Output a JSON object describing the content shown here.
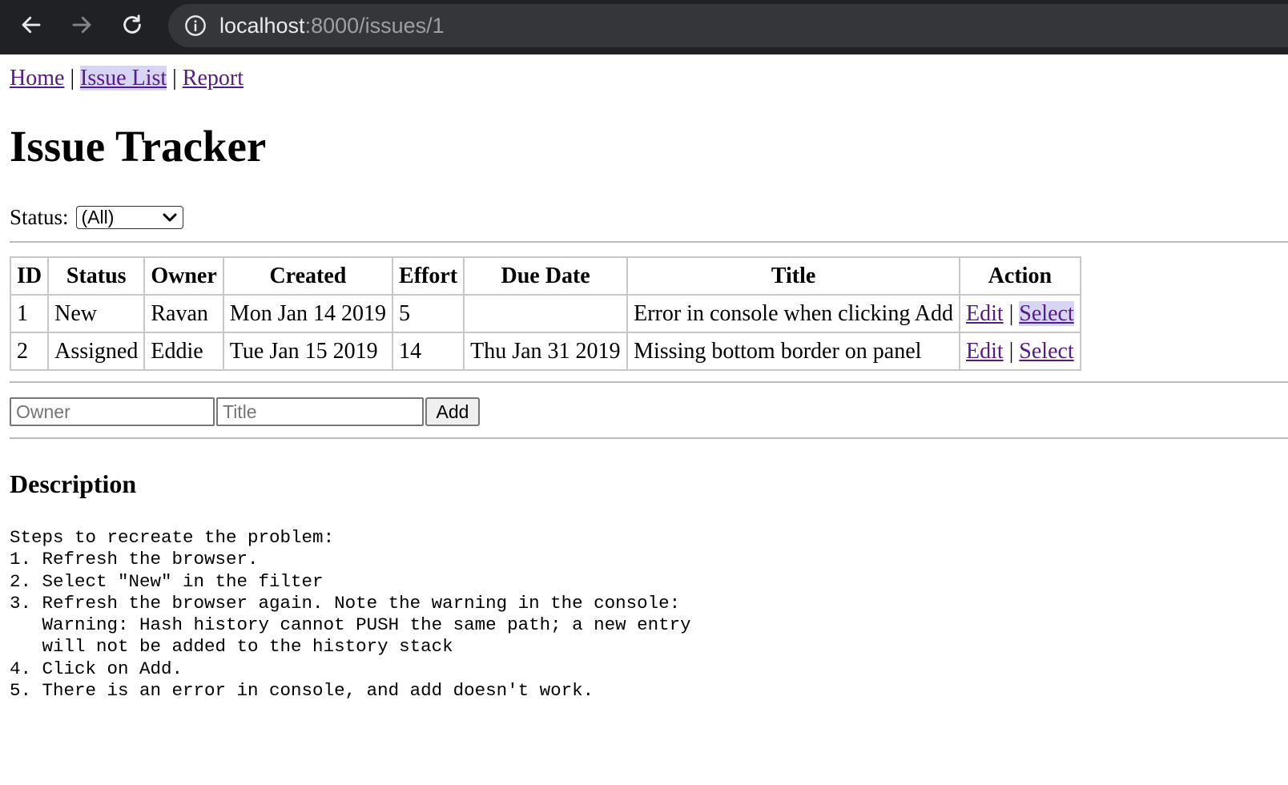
{
  "browser": {
    "url_host": "localhost",
    "url_path": ":8000/issues/1"
  },
  "nav": {
    "home": "Home",
    "issue_list": "Issue List",
    "report": "Report",
    "separator": "|"
  },
  "page_title": "Issue Tracker",
  "filter": {
    "label": "Status:",
    "selected": "(All)"
  },
  "table": {
    "headers": [
      "ID",
      "Status",
      "Owner",
      "Created",
      "Effort",
      "Due Date",
      "Title",
      "Action"
    ],
    "rows": [
      {
        "id": "1",
        "status": "New",
        "owner": "Ravan",
        "created": "Mon Jan 14 2019",
        "effort": "5",
        "due": "",
        "title": "Error in console when clicking Add",
        "edit": "Edit",
        "select": "Select"
      },
      {
        "id": "2",
        "status": "Assigned",
        "owner": "Eddie",
        "created": "Tue Jan 15 2019",
        "effort": "14",
        "due": "Thu Jan 31 2019",
        "title": "Missing bottom border on panel",
        "edit": "Edit",
        "select": "Select"
      }
    ],
    "action_separator": "|"
  },
  "add_form": {
    "owner_placeholder": "Owner",
    "title_placeholder": "Title",
    "add_label": "Add"
  },
  "description": {
    "heading": "Description",
    "text": "Steps to recreate the problem:\n1. Refresh the browser.\n2. Select \"New\" in the filter\n3. Refresh the browser again. Note the warning in the console:\n   Warning: Hash history cannot PUSH the same path; a new entry\n   will not be added to the history stack\n4. Click on Add.\n5. There is an error in console, and add doesn't work."
  }
}
